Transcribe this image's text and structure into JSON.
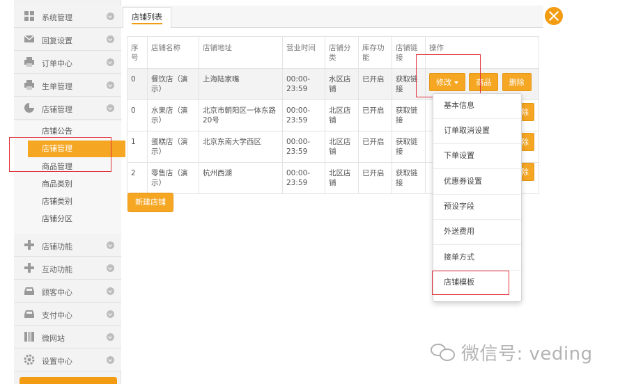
{
  "sidebar": {
    "menu": [
      {
        "label": "系统管理",
        "icon": "grid-icon"
      },
      {
        "label": "回复设置",
        "icon": "mail-icon"
      },
      {
        "label": "订单中心",
        "icon": "printer-icon"
      },
      {
        "label": "生单管理",
        "icon": "printer-icon"
      },
      {
        "label": "店铺管理",
        "icon": "pie-chart-icon"
      },
      {
        "label": "店铺功能",
        "icon": "plus-icon"
      },
      {
        "label": "互动功能",
        "icon": "plus-icon"
      },
      {
        "label": "顾客中心",
        "icon": "inbox-icon"
      },
      {
        "label": "支付中心",
        "icon": "inbox-icon"
      },
      {
        "label": "微网站",
        "icon": "columns-icon"
      },
      {
        "label": "设置中心",
        "icon": "gear-icon"
      }
    ],
    "submenu": [
      {
        "label": "店铺公告"
      },
      {
        "label": "店铺管理"
      },
      {
        "label": "商品管理"
      },
      {
        "label": "商品类别"
      },
      {
        "label": "店铺类别"
      },
      {
        "label": "店铺分区"
      }
    ]
  },
  "tabs": {
    "store_list": "店铺列表"
  },
  "table": {
    "headers": [
      "序号",
      "店铺名称",
      "店铺地址",
      "营业时间",
      "店铺分类",
      "库存功能",
      "店铺链接",
      "操作"
    ],
    "rows": [
      {
        "id": "0",
        "name": "餐饮店（演示）",
        "address": "上海陆家嘴",
        "hours": "00:00-23:59",
        "category": "水区店铺",
        "stock": "已开启",
        "link": "获取链接"
      },
      {
        "id": "0",
        "name": "水果店（演示）",
        "address": "北京市朝阳区一体东路20号",
        "hours": "00:00-23:59",
        "category": "北区店铺",
        "stock": "已开启",
        "link": "获取链接"
      },
      {
        "id": "1",
        "name": "蛋糕店（演示）",
        "address": "北京东南大学西区",
        "hours": "00:00-23:59",
        "category": "北区店铺",
        "stock": "已开启",
        "link": "获取链接"
      },
      {
        "id": "2",
        "name": "零售店（演示）",
        "address": "杭州西湖",
        "hours": "00:00-23:59",
        "category": "北区店铺",
        "stock": "已开启",
        "link": "获取链接"
      }
    ],
    "btn_edit": "修改",
    "btn_goods": "商品",
    "btn_delete": "删除",
    "partial_delete": "除"
  },
  "new_store_button": "新建店铺",
  "dropdown": [
    {
      "label": "基本信息"
    },
    {
      "label": "订单取消设置"
    },
    {
      "label": "下单设置"
    },
    {
      "label": "优惠券设置"
    },
    {
      "label": "预设字段"
    },
    {
      "label": "外送费用"
    },
    {
      "label": "接单方式"
    },
    {
      "label": "店铺模板"
    }
  ],
  "watermark": "微信号: veding",
  "colors": {
    "accent": "#f5a623",
    "annotation": "#e0303a",
    "link": "#4a8cc7"
  }
}
